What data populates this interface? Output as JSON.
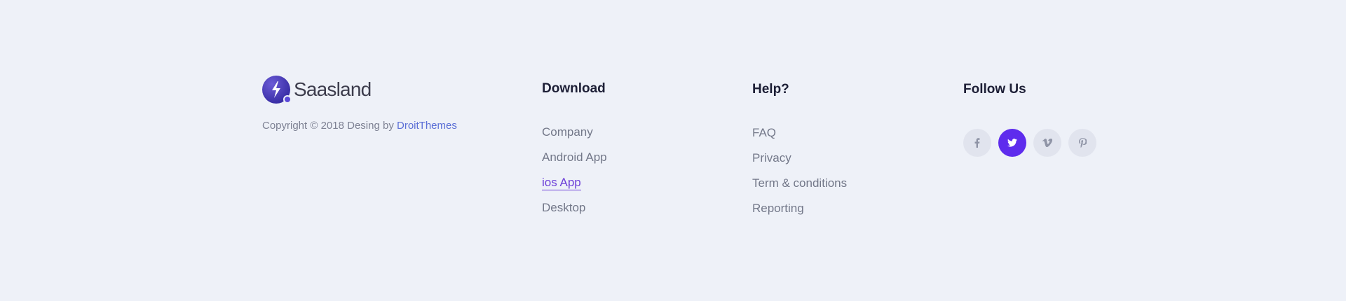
{
  "brand": {
    "name": "Saasland"
  },
  "copyright": {
    "text": "Copyright © 2018 Desing by ",
    "link": "DroitThemes"
  },
  "download": {
    "heading": "Download",
    "items": [
      "Company",
      "Android App",
      "ios App",
      "Desktop"
    ],
    "active_item": "ios App"
  },
  "help": {
    "heading": "Help?",
    "items": [
      "FAQ",
      "Privacy",
      "Term & conditions",
      "Reporting"
    ]
  },
  "follow": {
    "heading": "Follow Us",
    "icons": [
      "facebook-icon",
      "twitter-icon",
      "vimeo-icon",
      "pinterest-icon"
    ],
    "active_icon": "twitter-icon"
  },
  "colors": {
    "background": "#eef1f8",
    "accent": "#5e2ced",
    "link": "#5a6ed6"
  }
}
